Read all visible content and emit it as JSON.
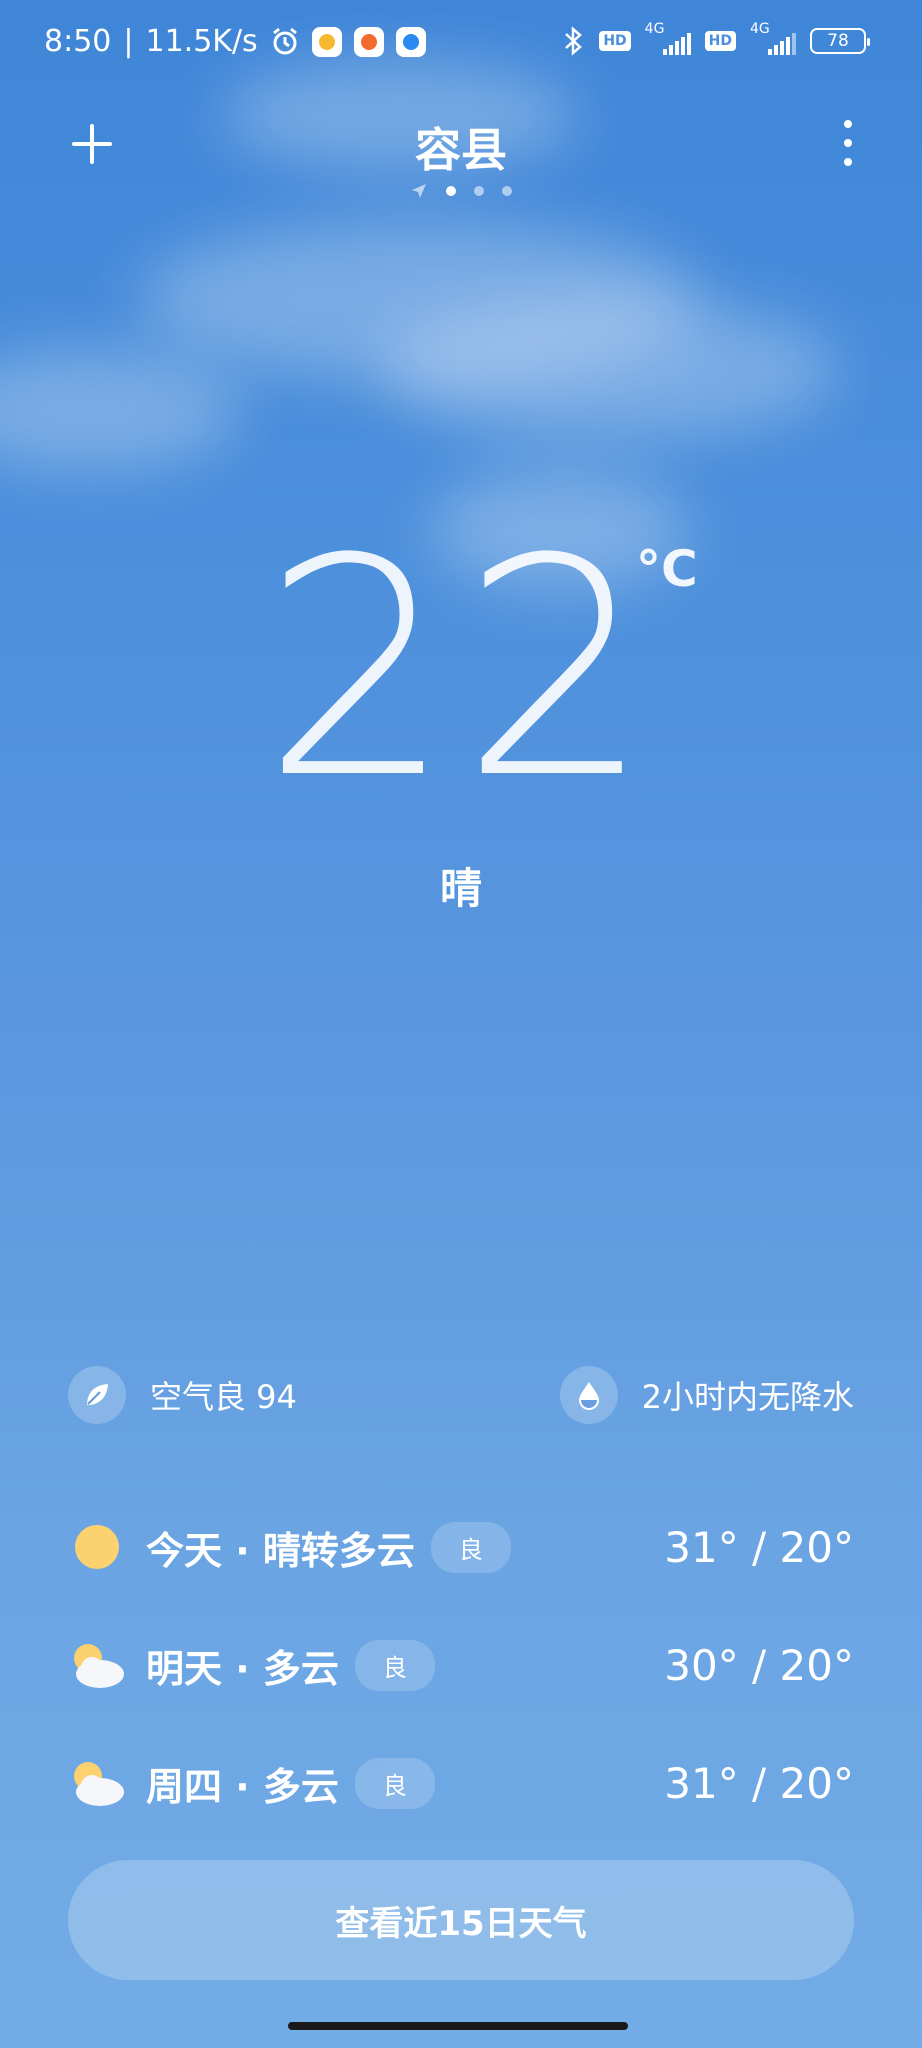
{
  "status_bar": {
    "time": "8:50",
    "separator": "|",
    "speed": "11.5K/s",
    "net1_label": "4G",
    "net2_label": "4G",
    "hd1": "HD",
    "hd2": "HD",
    "battery": "78"
  },
  "header": {
    "city": "容县",
    "page_count": 3,
    "active_page": 0
  },
  "current": {
    "temperature": "22",
    "unit": "°C",
    "condition": "晴"
  },
  "info": {
    "air_quality": "空气良 94",
    "precipitation": "2小时内无降水"
  },
  "forecast": [
    {
      "label": "今天 · 晴转多云",
      "badge": "良",
      "temps": "31° / 20°",
      "icon": "sun-icon"
    },
    {
      "label": "明天 · 多云",
      "badge": "良",
      "temps": "30° / 20°",
      "icon": "partly-cloudy-icon"
    },
    {
      "label": "周四 · 多云",
      "badge": "良",
      "temps": "31° / 20°",
      "icon": "partly-cloudy-icon"
    }
  ],
  "button_15day": "查看近15日天气",
  "colors": {
    "sky_top": "#3f86d8",
    "sky_bottom": "#73ace6",
    "sun": "#fcd170"
  }
}
